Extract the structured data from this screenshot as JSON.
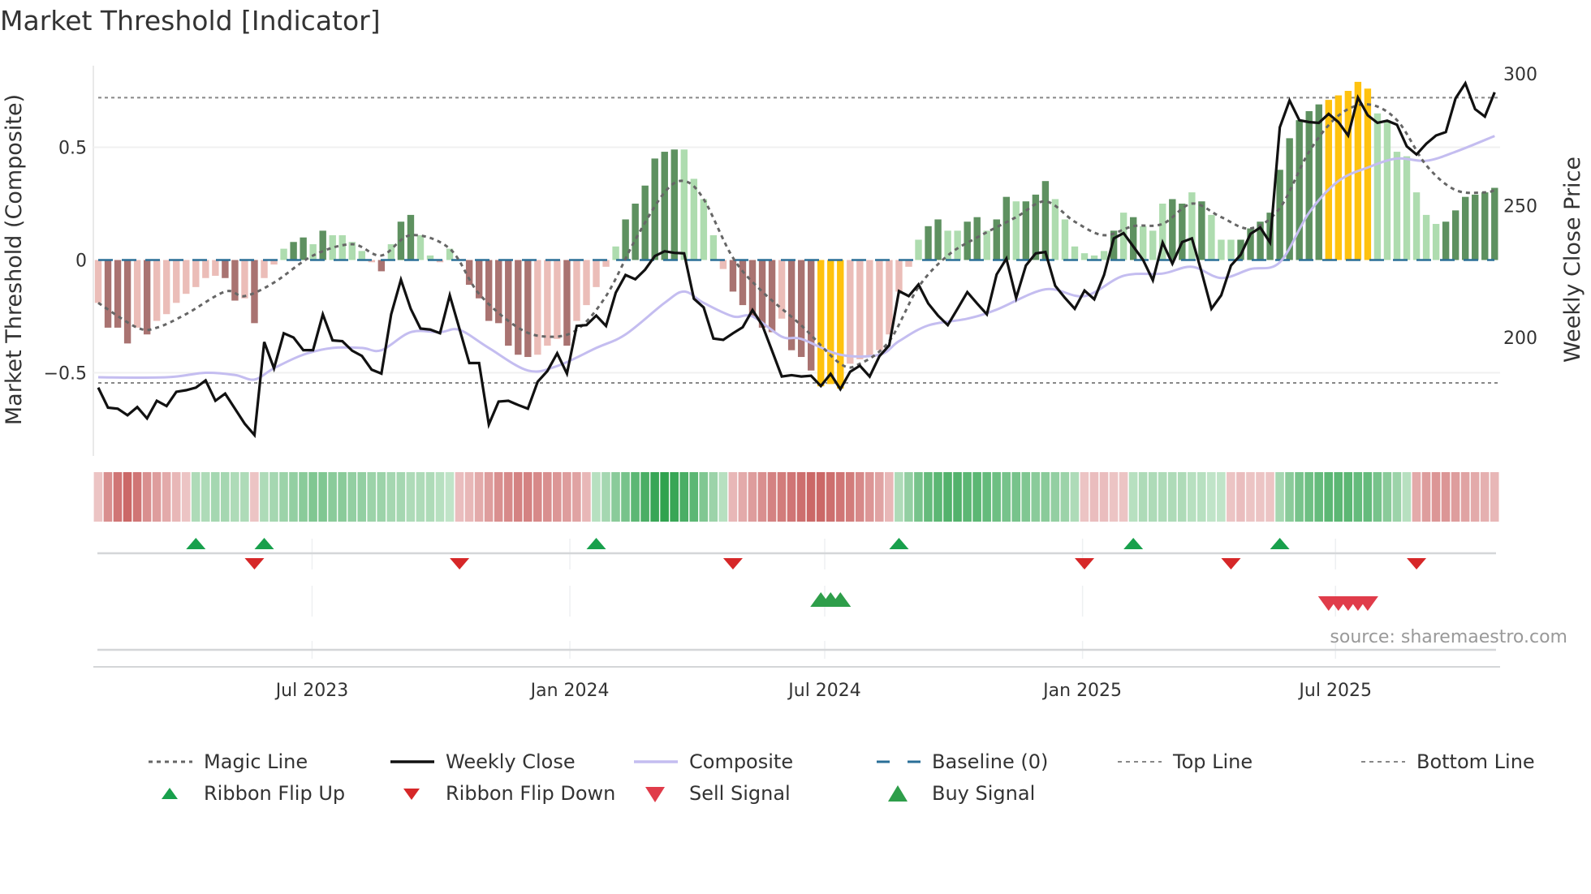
{
  "title": "Market Threshold [Indicator]",
  "source": "source: sharemaestro.com",
  "colors": {
    "bar_dark_pos": "#5e9160",
    "bar_light_pos": "#aedcaf",
    "bar_dark_neg": "#a97371",
    "bar_light_neg": "#ebbdb8",
    "bar_highlight": "#ffc20e",
    "weekly_close": "#111111",
    "composite": "#c4bdf0",
    "magic_line": "#666666",
    "baseline": "#2a6f97",
    "threshold_lines": "#888888",
    "flip_up": "#18a04c",
    "flip_down": "#d62728",
    "sell": "#e03c4a",
    "buy": "#2e9e4a"
  },
  "chart_data": {
    "type": "bar",
    "title": "Market Threshold [Indicator]",
    "ylabel": "Market Threshold (Composite)",
    "ylabel_right": "Weekly Close Price",
    "ylim": [
      -0.87,
      0.86
    ],
    "ylim_right": [
      160,
      305
    ],
    "y_ticks": [
      {
        "label": "0.5",
        "value": 0.5
      },
      {
        "label": "0",
        "value": 0
      },
      {
        "label": "−0.5",
        "value": -0.5
      }
    ],
    "y_ticks_right": [
      {
        "label": "300",
        "value": 300
      },
      {
        "label": "250",
        "value": 250
      },
      {
        "label": "200",
        "value": 200
      }
    ],
    "x_ticks": [
      {
        "label": "Jul 2023",
        "index": 21.9
      },
      {
        "label": "Jan 2024",
        "index": 48.3
      },
      {
        "label": "Jul 2024",
        "index": 74.4
      },
      {
        "label": "Jan 2025",
        "index": 100.8
      },
      {
        "label": "Jul 2025",
        "index": 126.7
      }
    ],
    "top_line": 0.72,
    "bottom_line": -0.545,
    "baseline": 0,
    "composite_bars": [
      -0.19,
      -0.3,
      -0.3,
      -0.37,
      -0.3,
      -0.33,
      -0.27,
      -0.24,
      -0.19,
      -0.15,
      -0.12,
      -0.08,
      -0.07,
      -0.08,
      -0.18,
      -0.17,
      -0.28,
      -0.08,
      -0.02,
      0.05,
      0.08,
      0.1,
      0.07,
      0.13,
      0.11,
      0.11,
      0.08,
      0.04,
      -0.01,
      -0.05,
      0.07,
      0.17,
      0.2,
      0.11,
      0.02,
      -0.01,
      0.05,
      0.0,
      -0.11,
      -0.17,
      -0.27,
      -0.28,
      -0.38,
      -0.42,
      -0.43,
      -0.42,
      -0.38,
      -0.35,
      -0.38,
      -0.27,
      -0.2,
      -0.12,
      -0.03,
      0.06,
      0.18,
      0.25,
      0.33,
      0.45,
      0.48,
      0.49,
      0.49,
      0.36,
      0.27,
      0.11,
      -0.04,
      -0.14,
      -0.2,
      -0.25,
      -0.3,
      -0.32,
      -0.26,
      -0.4,
      -0.43,
      -0.49,
      -0.56,
      -0.55,
      -0.57,
      -0.46,
      -0.44,
      -0.43,
      -0.4,
      -0.33,
      -0.14,
      -0.03,
      0.09,
      0.15,
      0.18,
      0.13,
      0.13,
      0.17,
      0.19,
      0.13,
      0.18,
      0.28,
      0.26,
      0.26,
      0.29,
      0.35,
      0.27,
      0.18,
      0.06,
      0.03,
      0.02,
      0.04,
      0.13,
      0.21,
      0.19,
      0.15,
      0.13,
      0.25,
      0.27,
      0.25,
      0.3,
      0.26,
      0.2,
      0.09,
      0.09,
      0.09,
      0.14,
      0.17,
      0.21,
      0.4,
      0.54,
      0.62,
      0.66,
      0.69,
      0.71,
      0.73,
      0.75,
      0.79,
      0.76,
      0.65,
      0.62,
      0.48,
      0.46,
      0.3,
      0.2,
      0.16,
      0.17,
      0.22,
      0.28,
      0.29,
      0.3,
      0.32
    ],
    "bar_states": "rRRRrRrrrrrrrRRrRrrgGGgGggggrRgGGggrggRRRRRRRrrrRrrrrgGGGGGGggggrRRRRRrRRRYYYrrrrrrrgGGggGGgGGgGGGggggggGgGgggGGgGgggGGGGGGGGGYYYYYgggggggGGGGGG",
    "bar_state_legend": {
      "G": "strong positive",
      "g": "weak positive",
      "R": "strong negative",
      "r": "weak negative",
      "Y": "extreme"
    },
    "weekly_close": [
      181,
      173.4,
      173,
      170.5,
      173.6,
      169.3,
      176,
      174,
      179.4,
      180,
      181,
      183.7,
      176,
      178.7,
      173,
      167.3,
      163,
      198.3,
      188.3,
      201.6,
      200,
      195.2,
      195.2,
      208.8,
      198.9,
      198.6,
      195,
      193,
      187.8,
      186.3,
      208.8,
      221.9,
      210.9,
      203.4,
      203,
      201.6,
      216,
      203.2,
      190.3,
      190.3,
      167,
      175.7,
      176,
      174.4,
      173,
      183.2,
      187.3,
      194,
      186.3,
      204.4,
      204.7,
      208.3,
      204.4,
      217,
      223.7,
      222.1,
      225.7,
      230.9,
      232.7,
      232.1,
      231.9,
      214.7,
      211.4,
      199.6,
      199.1,
      201.6,
      203.9,
      210.4,
      204.7,
      195,
      185.2,
      185.7,
      185.2,
      185.5,
      181.6,
      186.2,
      180.4,
      187,
      189.3,
      185.2,
      192.9,
      197,
      217.6,
      215.7,
      220.1,
      212.9,
      208.3,
      204.7,
      210.9,
      217.2,
      212.9,
      208.8,
      223.9,
      229.9,
      215,
      227.3,
      231.9,
      232.4,
      219.6,
      215,
      210.9,
      217.8,
      214.5,
      223.7,
      237.6,
      239.6,
      234.5,
      229.4,
      221.7,
      236,
      228,
      236.2,
      237.6,
      224.7,
      210.9,
      216,
      227.3,
      231.4,
      239.3,
      241.7,
      236,
      279.7,
      289.9,
      282.4,
      281.7,
      281.4,
      284.8,
      281.7,
      276.6,
      291,
      284.3,
      281.4,
      282.2,
      280.7,
      272.5,
      269.4,
      273.5,
      276.6,
      277.9,
      290.7,
      296.4,
      286.6,
      283.8,
      293
    ],
    "magic_line": [
      [
        0,
        -0.19
      ],
      [
        4,
        -0.3
      ],
      [
        6,
        -0.3
      ],
      [
        9,
        -0.24
      ],
      [
        13,
        -0.14
      ],
      [
        15,
        -0.16
      ],
      [
        18,
        -0.1
      ],
      [
        22,
        0.02
      ],
      [
        26,
        0.07
      ],
      [
        29,
        0.02
      ],
      [
        32,
        0.11
      ],
      [
        36,
        0.05
      ],
      [
        39,
        -0.15
      ],
      [
        43,
        -0.3
      ],
      [
        46,
        -0.34
      ],
      [
        49,
        -0.31
      ],
      [
        52,
        -0.16
      ],
      [
        55,
        0.09
      ],
      [
        58,
        0.3
      ],
      [
        60,
        0.35
      ],
      [
        62,
        0.27
      ],
      [
        65,
        0.01
      ],
      [
        68,
        -0.14
      ],
      [
        72,
        -0.29
      ],
      [
        76,
        -0.46
      ],
      [
        78,
        -0.46
      ],
      [
        81,
        -0.36
      ],
      [
        84,
        -0.12
      ],
      [
        87,
        0.02
      ],
      [
        90,
        0.1
      ],
      [
        94,
        0.19
      ],
      [
        97,
        0.26
      ],
      [
        100,
        0.17
      ],
      [
        103,
        0.11
      ],
      [
        106,
        0.15
      ],
      [
        109,
        0.16
      ],
      [
        112,
        0.25
      ],
      [
        115,
        0.19
      ],
      [
        118,
        0.14
      ],
      [
        121,
        0.23
      ],
      [
        124,
        0.48
      ],
      [
        127,
        0.64
      ],
      [
        130,
        0.69
      ],
      [
        133,
        0.62
      ],
      [
        136,
        0.42
      ],
      [
        139,
        0.31
      ],
      [
        142,
        0.3
      ],
      [
        143,
        0.31
      ]
    ],
    "composite_line": [
      [
        0,
        -0.52
      ],
      [
        7,
        -0.52
      ],
      [
        11,
        -0.5
      ],
      [
        14,
        -0.51
      ],
      [
        16,
        -0.53
      ],
      [
        18,
        -0.48
      ],
      [
        21,
        -0.42
      ],
      [
        24,
        -0.39
      ],
      [
        27,
        -0.39
      ],
      [
        29,
        -0.4
      ],
      [
        32,
        -0.32
      ],
      [
        35,
        -0.32
      ],
      [
        37,
        -0.31
      ],
      [
        40,
        -0.39
      ],
      [
        44,
        -0.49
      ],
      [
        47,
        -0.47
      ],
      [
        51,
        -0.39
      ],
      [
        54,
        -0.33
      ],
      [
        58,
        -0.19
      ],
      [
        60,
        -0.14
      ],
      [
        62,
        -0.19
      ],
      [
        65,
        -0.25
      ],
      [
        67,
        -0.25
      ],
      [
        70,
        -0.34
      ],
      [
        72,
        -0.35
      ],
      [
        76,
        -0.42
      ],
      [
        80,
        -0.42
      ],
      [
        82,
        -0.36
      ],
      [
        85,
        -0.29
      ],
      [
        89,
        -0.26
      ],
      [
        92,
        -0.22
      ],
      [
        97,
        -0.13
      ],
      [
        101,
        -0.16
      ],
      [
        105,
        -0.07
      ],
      [
        109,
        -0.06
      ],
      [
        112,
        -0.03
      ],
      [
        115,
        -0.08
      ],
      [
        118,
        -0.04
      ],
      [
        121,
        -0.01
      ],
      [
        124,
        0.21
      ],
      [
        127,
        0.35
      ],
      [
        130,
        0.41
      ],
      [
        133,
        0.45
      ],
      [
        136,
        0.44
      ],
      [
        139,
        0.48
      ],
      [
        143,
        0.55
      ]
    ],
    "ribbon": [
      -0.2,
      -0.6,
      -0.8,
      -0.9,
      -0.8,
      -0.6,
      -0.5,
      -0.4,
      -0.3,
      -0.2,
      0.3,
      0.3,
      0.35,
      0.35,
      0.3,
      0.3,
      -0.2,
      0.3,
      0.35,
      0.4,
      0.45,
      0.5,
      0.55,
      0.55,
      0.5,
      0.5,
      0.45,
      0.45,
      0.4,
      0.4,
      0.35,
      0.35,
      0.3,
      0.3,
      0.3,
      0.25,
      0.2,
      -0.25,
      -0.3,
      -0.4,
      -0.5,
      -0.6,
      -0.65,
      -0.7,
      -0.7,
      -0.65,
      -0.6,
      -0.55,
      -0.5,
      -0.45,
      -0.3,
      0.25,
      0.35,
      0.5,
      0.6,
      0.75,
      0.85,
      0.95,
      1,
      0.95,
      0.85,
      0.75,
      0.55,
      0.4,
      0.25,
      -0.3,
      -0.4,
      -0.5,
      -0.6,
      -0.7,
      -0.75,
      -0.8,
      -0.85,
      -0.9,
      -0.9,
      -0.85,
      -0.8,
      -0.75,
      -0.65,
      -0.55,
      -0.45,
      -0.3,
      0.3,
      0.45,
      0.6,
      0.7,
      0.75,
      0.8,
      0.8,
      0.75,
      0.75,
      0.7,
      0.65,
      0.6,
      0.6,
      0.55,
      0.5,
      0.5,
      0.45,
      0.4,
      0.3,
      -0.2,
      -0.25,
      -0.25,
      -0.2,
      -0.2,
      0.25,
      0.3,
      0.3,
      0.3,
      0.3,
      0.3,
      0.25,
      0.25,
      0.2,
      0.2,
      -0.2,
      -0.25,
      -0.2,
      -0.2,
      -0.2,
      0.35,
      0.5,
      0.6,
      0.65,
      0.7,
      0.75,
      0.75,
      0.75,
      0.7,
      0.7,
      0.6,
      0.5,
      0.4,
      0.25,
      -0.4,
      -0.5,
      -0.55,
      -0.55,
      -0.5,
      -0.45,
      -0.4,
      -0.35,
      -0.3
    ],
    "ribbon_flip_up": [
      10,
      17,
      51,
      82,
      106,
      121
    ],
    "ribbon_flip_down": [
      16,
      37,
      65,
      101,
      116,
      135
    ],
    "buy_signals": [
      74,
      75,
      76
    ],
    "sell_signals": [
      126,
      127,
      128,
      129,
      130
    ],
    "legend": [
      {
        "label": "Magic Line",
        "kind": "dotted"
      },
      {
        "label": "Weekly Close",
        "kind": "solid-black"
      },
      {
        "label": "Composite",
        "kind": "solid-lavender"
      },
      {
        "label": "Baseline (0)",
        "kind": "dashed-blue"
      },
      {
        "label": "Top Line",
        "kind": "dotted-thin"
      },
      {
        "label": "Bottom Line",
        "kind": "dotted-thin"
      },
      {
        "label": "Ribbon Flip Up",
        "kind": "flip-up"
      },
      {
        "label": "Ribbon Flip Down",
        "kind": "flip-down"
      },
      {
        "label": "Sell Signal",
        "kind": "sell"
      },
      {
        "label": "Buy Signal",
        "kind": "buy"
      }
    ]
  }
}
